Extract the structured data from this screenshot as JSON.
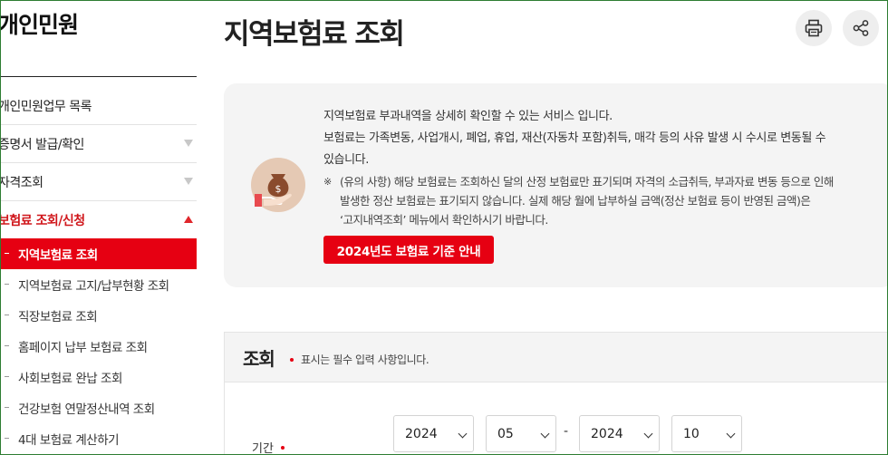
{
  "sidebar": {
    "title": "개인민원",
    "menu": [
      {
        "label": "개인민원업무 목록",
        "has_arrow": false
      },
      {
        "label": "증명서 발급/확인",
        "has_arrow": true
      },
      {
        "label": "자격조회",
        "has_arrow": true
      },
      {
        "label": "보험료 조회/신청",
        "has_arrow": true,
        "open": true
      }
    ],
    "submenu": [
      {
        "label": "지역보험료 조회",
        "active": true
      },
      {
        "label": "지역보험료 고지/납부현황 조회"
      },
      {
        "label": "직장보험료 조회"
      },
      {
        "label": "홈페이지 납부 보험료 조회"
      },
      {
        "label": "사회보험료 완납 조회"
      },
      {
        "label": "건강보험 연말정산내역 조회"
      },
      {
        "label": "4대 보험료 계산하기"
      }
    ]
  },
  "header": {
    "title": "지역보험료 조회",
    "print_icon": "printer-icon",
    "share_icon": "share-icon"
  },
  "info": {
    "lines": [
      "지역보험료 부과내역을 상세히 확인할 수 있는 서비스 입니다.",
      "보험료는 가족변동, 사업개시, 폐업, 휴업, 재산(자동차 포함)취득, 매각 등의 사유 발생 시 수시로 변동될 수",
      "있습니다."
    ],
    "note_mark": "※",
    "note_lines": [
      "(유의 사항) 해당 보험료는 조회하신 달의 산정 보험료만 표기되며 자격의 소급취득, 부과자료 변동 등으로 인해",
      "발생한 정산 보험료는 표기되지 않습니다. 실제 해당 월에 납부하실 금액(정산 보험료 등이 반영된 금액)은",
      "‘고지내역조회’ 메뉴에서 확인하시기 바랍니다."
    ],
    "guide_button": "2024년도 보험료 기준 안내",
    "icon": "money-bag-hand-icon"
  },
  "query": {
    "title": "조회",
    "required_note": "표시는 필수 입력 사항입니다.",
    "period_label": "기간",
    "range_separator": "-",
    "from_year": "2024",
    "from_month": "05",
    "to_year": "2024",
    "to_month": "10"
  },
  "colors": {
    "accent": "#e60012",
    "panel": "#f4f4f4"
  }
}
